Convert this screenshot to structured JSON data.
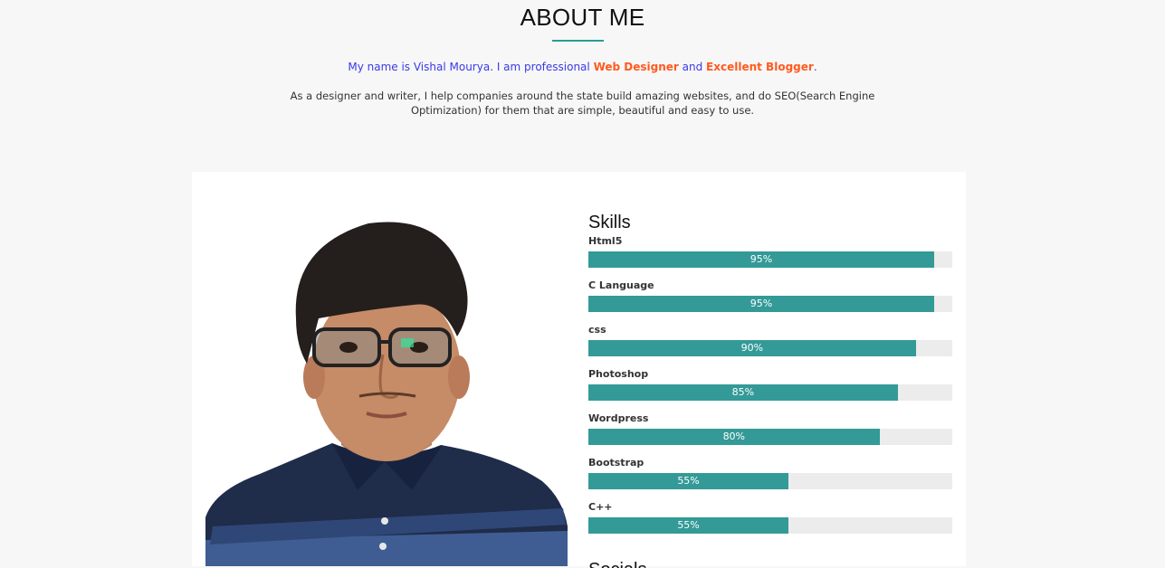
{
  "about": {
    "title": "ABOUT ME",
    "intro_prefix": "My name is Vishal Mourya. I am professional ",
    "intro_highlight_1": "Web Designer",
    "intro_middle": " and ",
    "intro_highlight_2": "Excellent Blogger",
    "intro_suffix": ".",
    "description": "As a designer and writer, I help companies around the state build amazing websites, and do SEO(Search Engine Optimization) for them that are simple, beautiful and easy to use."
  },
  "skills": {
    "title": "Skills",
    "items": [
      {
        "name": "Html5",
        "percent": 95,
        "label": "95%"
      },
      {
        "name": "C Language",
        "percent": 95,
        "label": "95%"
      },
      {
        "name": "css",
        "percent": 90,
        "label": "90%"
      },
      {
        "name": "Photoshop",
        "percent": 85,
        "label": "85%"
      },
      {
        "name": "Wordpress",
        "percent": 80,
        "label": "80%"
      },
      {
        "name": "Bootstrap",
        "percent": 55,
        "label": "55%"
      },
      {
        "name": "C++",
        "percent": 55,
        "label": "55%"
      }
    ]
  },
  "next_section": {
    "title": "Socials"
  },
  "colors": {
    "accent": "#339a97",
    "intro_text": "#3a3ae8",
    "highlight": "#ff5a1f",
    "bar_track": "#ececec"
  }
}
